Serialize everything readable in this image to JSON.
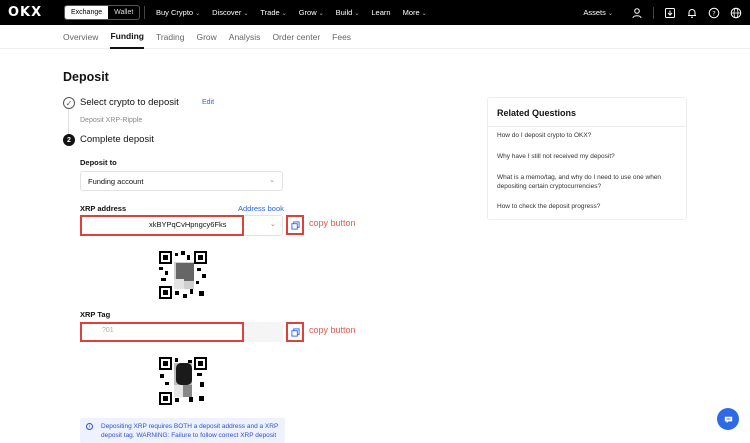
{
  "brand": {
    "logo_text": "OKX"
  },
  "topnav": {
    "toggle": {
      "exchange": "Exchange",
      "wallet": "Wallet"
    },
    "items": [
      {
        "label": "Buy Crypto",
        "has_chevron": true
      },
      {
        "label": "Discover",
        "has_chevron": true
      },
      {
        "label": "Trade",
        "has_chevron": true
      },
      {
        "label": "Grow",
        "has_chevron": true
      },
      {
        "label": "Build",
        "has_chevron": true
      },
      {
        "label": "Learn",
        "has_chevron": false
      },
      {
        "label": "More",
        "has_chevron": true
      }
    ],
    "assets_label": "Assets",
    "icons": [
      "user-icon",
      "download-icon",
      "bell-icon",
      "help-icon",
      "globe-icon"
    ]
  },
  "subnav": {
    "tabs": [
      "Overview",
      "Funding",
      "Trading",
      "Grow",
      "Analysis",
      "Order center",
      "Fees"
    ],
    "active": "Funding"
  },
  "page": {
    "title": "Deposit",
    "step1": {
      "title": "Select crypto to deposit",
      "edit": "Edit",
      "subtitle": "Deposit XRP-Ripple"
    },
    "step2": {
      "number": "2",
      "title": "Complete deposit"
    },
    "deposit_to": {
      "label": "Deposit to",
      "value": "Funding account"
    },
    "address": {
      "label": "XRP address",
      "book_link": "Address book",
      "value": "xkBYPqCvHpngcy6Fks"
    },
    "tag": {
      "label": "XRP Tag",
      "value": "?01"
    },
    "annotations": {
      "copy1": "copy button",
      "copy2": "copy button"
    },
    "warning": "Depositing XRP requires BOTH a deposit address and a XRP deposit tag. WARNING: Failure to follow correct XRP deposit"
  },
  "related": {
    "title": "Related Questions",
    "questions": [
      "How do I deposit crypto to OKX?",
      "Why have I still not received my deposit?",
      "What is a memo/tag, and why do I need to use one when depositing certain cryptocurrencies?",
      "How to check the deposit progress?"
    ]
  },
  "colors": {
    "accent": "#2962ff",
    "highlight": "#d9433a",
    "chat": "#2f6ae6"
  }
}
